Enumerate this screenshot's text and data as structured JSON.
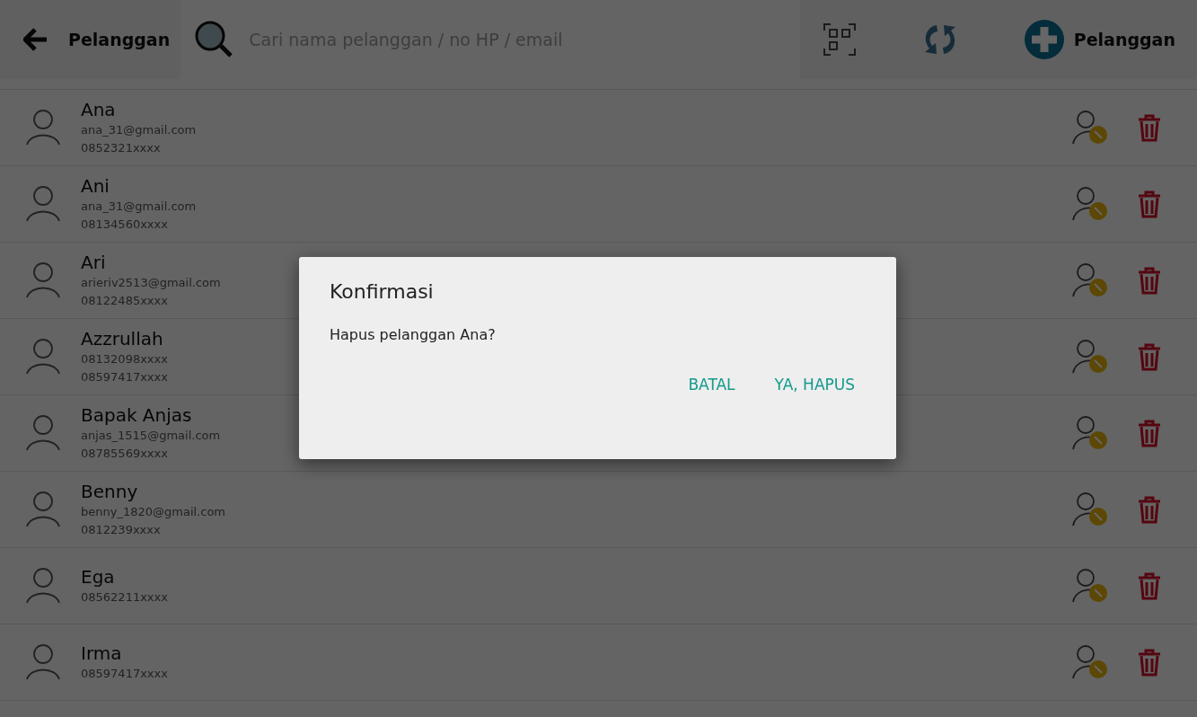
{
  "toolbar": {
    "title": "Pelanggan",
    "search": {
      "placeholder": "Cari nama pelanggan / no HP / email"
    },
    "add_label": "Pelanggan"
  },
  "customers": [
    {
      "name": "Ana",
      "details": [
        "ana_31@gmail.com",
        "0852321xxxx"
      ]
    },
    {
      "name": "Ani",
      "details": [
        "ana_31@gmail.com",
        "08134560xxxx"
      ]
    },
    {
      "name": "Ari",
      "details": [
        "arieriv2513@gmail.com",
        "08122485xxxx"
      ]
    },
    {
      "name": "Azzrullah",
      "details": [
        "08132098xxxx",
        "08597417xxxx"
      ]
    },
    {
      "name": "Bapak Anjas",
      "details": [
        "anjas_1515@gmail.com",
        "08785569xxxx"
      ]
    },
    {
      "name": "Benny",
      "details": [
        "benny_1820@gmail.com",
        "0812239xxxx"
      ]
    },
    {
      "name": "Ega",
      "details": [
        "08562211xxxx"
      ]
    },
    {
      "name": "Irma",
      "details": [
        "08597417xxxx"
      ]
    }
  ],
  "dialog": {
    "title": "Konfirmasi",
    "message": "Hapus pelanggan Ana?",
    "buttons": [
      "BATAL",
      "YA, HAPUS"
    ]
  }
}
